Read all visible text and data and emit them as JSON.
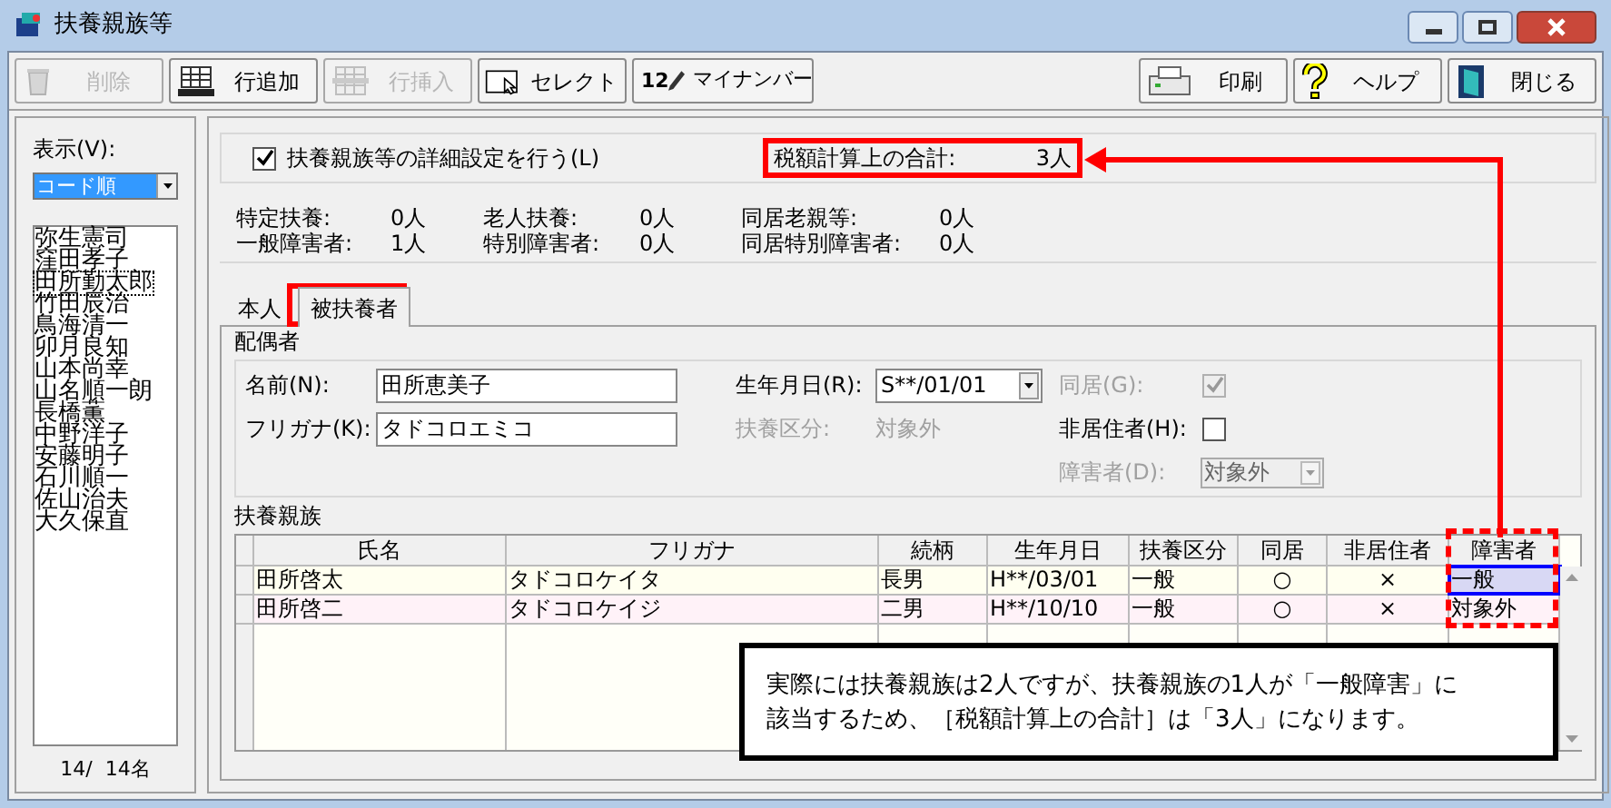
{
  "window": {
    "title": "扶養親族等"
  },
  "toolbar": {
    "left": [
      {
        "label": "削除",
        "kind": "trash",
        "disabled": true
      },
      {
        "label": "行追加",
        "kind": "gridadd",
        "disabled": false
      },
      {
        "label": "行挿入",
        "kind": "gridinsert",
        "disabled": true
      },
      {
        "label": "セレクト",
        "kind": "cursor",
        "disabled": false
      },
      {
        "label": "マイナンバー",
        "kind": "number",
        "icon_text": "12",
        "disabled": false
      }
    ],
    "right": [
      {
        "label": "印刷",
        "kind": "printer",
        "disabled": false
      },
      {
        "label": "ヘルプ",
        "kind": "help",
        "disabled": false
      },
      {
        "label": "閉じる",
        "kind": "door",
        "disabled": false
      }
    ]
  },
  "sidebar": {
    "display_label": "表示(V):",
    "sort_dropdown": {
      "value": "コード順"
    },
    "employees": [
      {
        "name": "弥生憲司",
        "selected": false
      },
      {
        "name": "窪田孝子",
        "selected": false
      },
      {
        "name": "田所勤太郎",
        "selected": true
      },
      {
        "name": "竹田辰治",
        "selected": false
      },
      {
        "name": "鳥海清一",
        "selected": false
      },
      {
        "name": "卯月良知",
        "selected": false
      },
      {
        "name": "山本尚幸",
        "selected": false
      },
      {
        "name": "山名順一朗",
        "selected": false
      },
      {
        "name": "長橋薫",
        "selected": false
      },
      {
        "name": "中野洋子",
        "selected": false
      },
      {
        "name": "安藤明子",
        "selected": false
      },
      {
        "name": "石川順一",
        "selected": false
      },
      {
        "name": "佐山治夫",
        "selected": false
      },
      {
        "name": "大久保直",
        "selected": false
      }
    ],
    "count": "14/  14名"
  },
  "detail_checkbox": {
    "label": "扶養親族等の詳細設定を行う(L)",
    "checked": true
  },
  "tax_total": {
    "label": "税額計算上の合計:",
    "value": "3人"
  },
  "summary": [
    {
      "label": "特定扶養:",
      "value": "0人"
    },
    {
      "label": "老人扶養:",
      "value": "0人"
    },
    {
      "label": "同居老親等:",
      "value": "0人"
    },
    {
      "label": "一般障害者:",
      "value": "1人"
    },
    {
      "label": "特別障害者:",
      "value": "0人"
    },
    {
      "label": "同居特別障害者:",
      "value": "0人"
    }
  ],
  "tabs": [
    {
      "label": "本人",
      "selected": false
    },
    {
      "label": "被扶養者",
      "selected": true
    }
  ],
  "spouse": {
    "title": "配偶者",
    "name": {
      "label": "名前(N):",
      "value": "田所恵美子"
    },
    "kana": {
      "label": "フリガナ(K):",
      "value": "タドコロエミコ"
    },
    "birthdate": {
      "label": "生年月日(R):",
      "value": "S**/01/01"
    },
    "dependent_class": {
      "label": "扶養区分:",
      "value": "対象外",
      "disabled": true
    },
    "cohabit": {
      "label": "同居(G):",
      "checked": true,
      "disabled": true
    },
    "nonresident": {
      "label": "非居住者(H):",
      "checked": false,
      "disabled": false
    },
    "disability": {
      "label": "障害者(D):",
      "value": "対象外",
      "disabled": true
    }
  },
  "dependents": {
    "title": "扶養親族",
    "columns": [
      "氏名",
      "フリガナ",
      "続柄",
      "生年月日",
      "扶養区分",
      "同居",
      "非居住者",
      "障害者"
    ],
    "rows": [
      {
        "cells": [
          "田所啓太",
          "タドコロケイタ",
          "長男",
          "H**/03/01",
          "一般",
          "○",
          "×",
          "一般"
        ],
        "focused": true
      },
      {
        "cells": [
          "田所啓二",
          "タドコロケイジ",
          "二男",
          "H**/10/10",
          "一般",
          "○",
          "×",
          "対象外"
        ],
        "focused": false
      }
    ]
  },
  "callout": {
    "lines": [
      "実際には扶養親族は2人ですが、扶養親族の1人が「一般障害」に",
      "該当するため、［税額計算上の合計］は「3人」になります。"
    ]
  }
}
